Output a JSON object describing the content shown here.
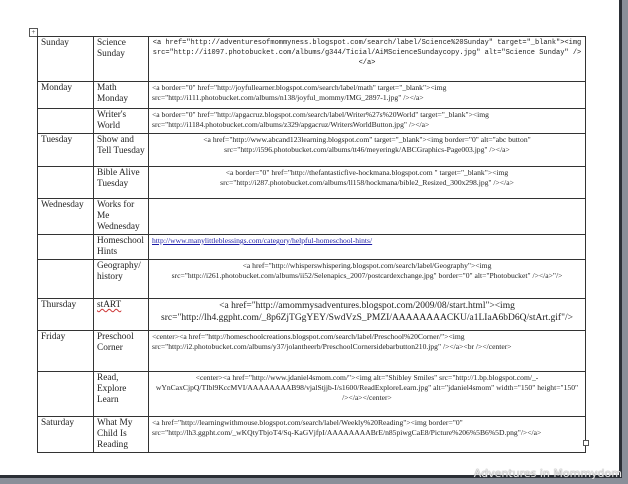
{
  "rows": [
    {
      "day": "Sunday",
      "program": "Science Sunday",
      "code": "<a href=\"http://adventuresofmommyness.blogspot.com/search/label/Science%20Sunday\" target=\"_blank\"><img src=\"http://i1097.photobucket.com/albums/g344/Ticial/AiMScienceSundaycopy.jpg\" alt=\"Science Sunday\" /></a>"
    },
    {
      "day": "Monday",
      "program": "Math Monday",
      "code": "<a border=\"0\" href=\"http://joyfullearner.blogspot.com/search/label/math\" target=\"_blank\"><img src=\"http://i111.photobucket.com/albums/n138/joyful_mommy/IMG_2897-1.jpg\" /></a>"
    },
    {
      "day": "",
      "program": "Writer's World",
      "code": "<a border=\"0\" href=\"http://apgacruz.blogspot.com/search/label/Writer%27s%20World\" target=\"_blank\"><img src=\"http://i1184.photobucket.com/albums/z329/apgacruz/WritersWorldButton.jpg\" /></a>"
    },
    {
      "day": "Tuesday",
      "program": "Show and Tell Tuesday",
      "code": "<a href=\"http://www.abcand123learning.blogspot.com\" target=\"_blank\"><img border=\"0\" alt=\"abc button\" src=\"http://i596.photobucket.com/albums/tt46/meyeringk/ABCGraphics-Page003.jpg\" /></a>"
    },
    {
      "day": "",
      "program": "Bible Alive Tuesday",
      "code": "<a border=\"0\" href=\"http://thefantasticfive-hockmana.blogspot.com \" target=\"_blank\"><img src=\"http://i287.photobucket.com/albums/ll158/hockmana/bible2_Resized_300x298.jpg\" /></a>"
    },
    {
      "day": "Wednesday",
      "program": "Works for Me Wednesday",
      "code": ""
    },
    {
      "day": "",
      "program": "Homeschool Hints",
      "code": "http://www.manylittleblessings.com/category/helpful-homeschool-hints/"
    },
    {
      "day": "",
      "program": "Geography/ history",
      "code": "<a href=\"http://whisperswhispering.blogspot.com/search/label/Geography\"><img src=\"http://i261.photobucket.com/albums/ii52/Selenapics_2007/postcardexchange.jpg\" border=\"0\" alt=\"Photobucket\" /></a>\"/>"
    },
    {
      "day": "Thursday",
      "program": "stART",
      "code": "<a href=\"http://amommysadventures.blogspot.com/2009/08/start.html\"><img src=\"http://lh4.ggpht.com/_8p6ZjTGgYEY/SwdVzS_PMZI/AAAAAAAACKU/a1LIaA6bD6Q/stArt.gif\"/>"
    },
    {
      "day": "Friday",
      "program": "Preschool Corner",
      "code": "<center><a href=\"http://homeschoolcreations.blogspot.com/search/label/Preschool%20Corner/\"><img src=\"http://i2.photobucket.com/albums/y37/jolantheerb/PreschoolCornersidebarbutton210.jpg\" /></a><br /></center>"
    },
    {
      "day": "",
      "program": "Read, Explore Learn",
      "code": "<center><a href=\"http://www.jdaniel4smom.com/\"><img alt=\"Shibley Smiles\" src=\"http://1.bp.blogspot.com/_-wYnCaxCjpQ/TIbl9KccMVI/AAAAAAAAB98/vjalStjjb-I/s1600/ReadExploreLearn.jpg\" alt=\"jdaniel4smom\" width=\"150\" height=\"150\" /></a></center>"
    },
    {
      "day": "Saturday",
      "program": "What My Child Is Reading",
      "code": "<a href=\"http://learningwithmouse.blogspot.com/search/label/Weekly%20Reading\"><img border=\"0\" src=\"http://lh3.ggpht.com/_wKQtyTbjoT4/Sq-KaGVjfpI/AAAAAAAABrE/n85piwgCaE8/Picture%206%5B6%5D.png\"/></a>"
    }
  ],
  "watermark": "Adventures in Mommydom"
}
